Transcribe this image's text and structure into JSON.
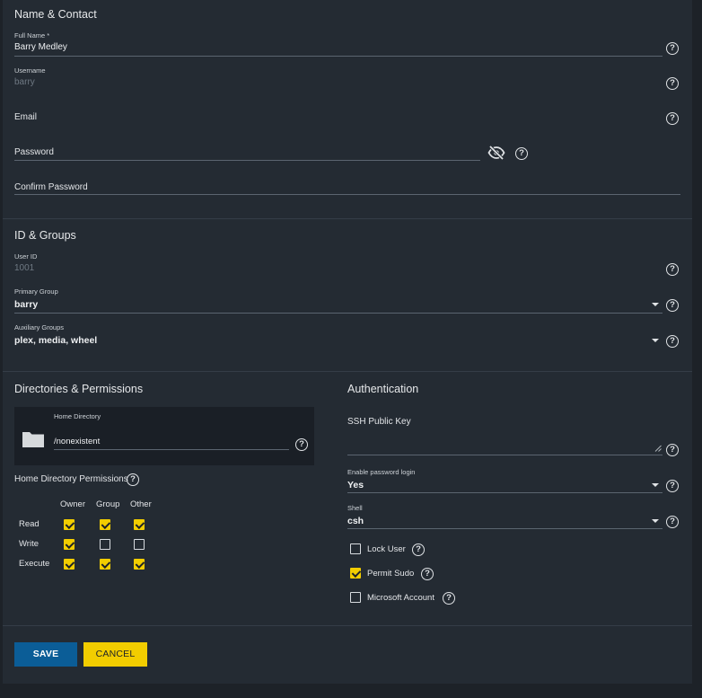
{
  "sections": {
    "name_contact": "Name & Contact",
    "id_groups": "ID & Groups",
    "directories": "Directories & Permissions",
    "authentication": "Authentication"
  },
  "fields": {
    "full_name": {
      "label": "Full Name *",
      "value": "Barry Medley"
    },
    "username": {
      "label": "Username",
      "value": "barry"
    },
    "email": {
      "label": "Email"
    },
    "password": {
      "label": "Password"
    },
    "confirm_password": {
      "label": "Confirm Password"
    },
    "user_id": {
      "label": "User ID",
      "value": "1001"
    },
    "primary_group": {
      "label": "Primary Group",
      "value": "barry"
    },
    "aux_groups": {
      "label": "Auxiliary Groups",
      "value": "plex, media, wheel"
    },
    "home_dir": {
      "label": "Home Directory",
      "value": "/nonexistent"
    },
    "ssh_key": {
      "label": "SSH Public Key"
    },
    "password_login": {
      "label": "Enable password login",
      "value": "Yes"
    },
    "shell": {
      "label": "Shell",
      "value": "csh"
    }
  },
  "permissions": {
    "title": "Home Directory Permissions",
    "columns": [
      "Owner",
      "Group",
      "Other"
    ],
    "rows": [
      {
        "label": "Read",
        "values": [
          true,
          true,
          true
        ]
      },
      {
        "label": "Write",
        "values": [
          true,
          false,
          false
        ]
      },
      {
        "label": "Execute",
        "values": [
          true,
          true,
          true
        ]
      }
    ]
  },
  "options": {
    "lock_user": {
      "label": "Lock User",
      "checked": false
    },
    "permit_sudo": {
      "label": "Permit Sudo",
      "checked": true
    },
    "microsoft_account": {
      "label": "Microsoft Account",
      "checked": false
    }
  },
  "buttons": {
    "save": "SAVE",
    "cancel": "CANCEL"
  },
  "colors": {
    "accent": "#f2cd00",
    "primary": "#0b5d97",
    "background": "#242b33"
  },
  "icons": {
    "password_visibility": "eye-off-icon",
    "help": "help-circle-icon",
    "folder": "folder-icon"
  }
}
